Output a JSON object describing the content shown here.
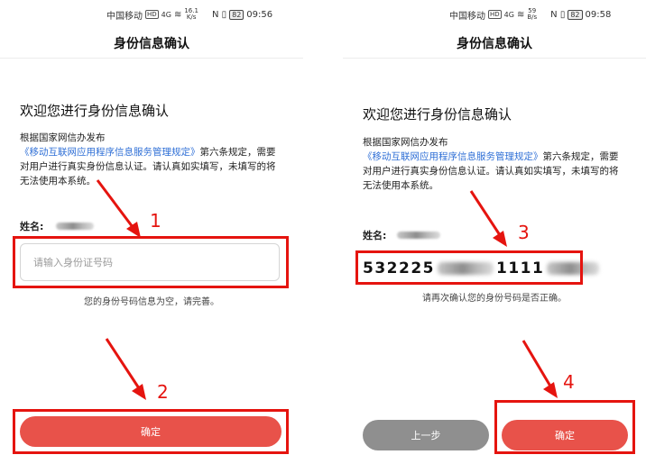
{
  "left": {
    "status": {
      "carrier": "中国移动",
      "net": "HD",
      "signal": "4G",
      "speed_top": "16.1",
      "speed_bottom": "K/s",
      "icons": "N ▯",
      "battery": "82",
      "time": "09:56"
    },
    "title": "身份信息确认",
    "welcome": "欢迎您进行身份信息确认",
    "intro_prefix": "根据国家网信办发布",
    "intro_link": "《移动互联网应用程序信息服务管理规定》",
    "intro_suffix": "第六条规定，需要对用户进行真实身份信息认证。请认真如实填写，未填写的将无法使用本系统。",
    "name_label": "姓名:",
    "id_placeholder": "请输入身份证号码",
    "hint": "您的身份号码信息为空，请完善。",
    "confirm_button": "确定",
    "step_1": "1",
    "step_2": "2"
  },
  "right": {
    "status": {
      "carrier": "中国移动",
      "net": "HD",
      "signal": "4G",
      "speed_top": "59",
      "speed_bottom": "B/s",
      "icons": "N ▯",
      "battery": "82",
      "time": "09:58"
    },
    "title": "身份信息确认",
    "welcome": "欢迎您进行身份信息确认",
    "intro_prefix": "根据国家网信办发布",
    "intro_link": "《移动互联网应用程序信息服务管理规定》",
    "intro_suffix": "第六条规定，需要对用户进行真实身份信息认证。请认真如实填写，未填写的将无法使用本系统。",
    "name_label": "姓名:",
    "id_part1": "532225",
    "id_part2": "1111",
    "hint": "请再次确认您的身份号码是否正确。",
    "prev_button": "上一步",
    "confirm_button": "确定",
    "step_3": "3",
    "step_4": "4"
  },
  "colors": {
    "accent": "#e8524a",
    "annotation": "#e5140f",
    "link": "#2f6fd6",
    "secondary_button": "#8f8f8f"
  }
}
